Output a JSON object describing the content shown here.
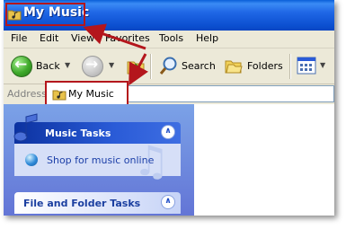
{
  "window": {
    "title": "My Music"
  },
  "menu": [
    "File",
    "Edit",
    "View",
    "Favorites",
    "Tools",
    "Help"
  ],
  "toolbar": {
    "back_label": "Back",
    "search_label": "Search",
    "folders_label": "Folders"
  },
  "address": {
    "label": "Address",
    "value": "My Music"
  },
  "task_pane": {
    "music_tasks": {
      "title": "Music Tasks",
      "items": [
        "Shop for music online"
      ]
    },
    "file_folder_tasks": {
      "title": "File and Folder Tasks"
    }
  },
  "colors": {
    "titlebar_blue": "#0b4fd0",
    "highlight_red": "#b4161c",
    "taskpane_blue": "#6f8fe0"
  }
}
